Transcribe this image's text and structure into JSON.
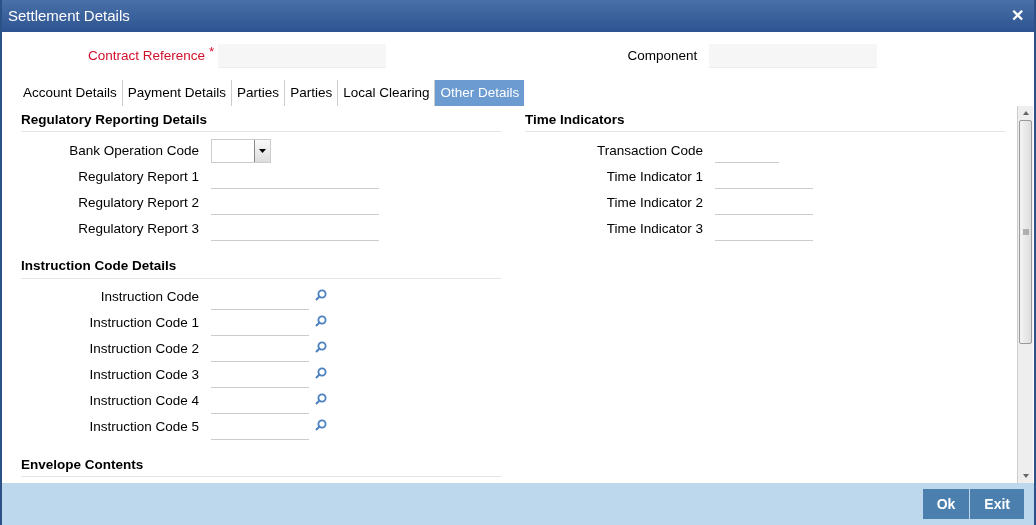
{
  "window": {
    "title": "Settlement Details",
    "close": "✕"
  },
  "header": {
    "contract_reference": {
      "label": "Contract Reference",
      "required": true,
      "required_mark": "*"
    },
    "component": {
      "label": "Component"
    }
  },
  "tabs": [
    {
      "label": "Account Details",
      "selected": false
    },
    {
      "label": "Payment Details",
      "selected": false
    },
    {
      "label": "Parties",
      "selected": false
    },
    {
      "label": "Parties",
      "selected": false
    },
    {
      "label": "Local Clearing",
      "selected": false
    },
    {
      "label": "Other Details",
      "selected": true
    }
  ],
  "left_sections": [
    {
      "title": "Regulatory Reporting Details",
      "fields": [
        {
          "label": "Bank Operation Code",
          "kind": "select"
        },
        {
          "label": "Regulatory Report 1",
          "kind": "text"
        },
        {
          "label": "Regulatory Report 2",
          "kind": "text"
        },
        {
          "label": "Regulatory Report 3",
          "kind": "text"
        }
      ]
    },
    {
      "title": "Instruction Code Details",
      "fields": [
        {
          "label": "Instruction Code",
          "kind": "lookup"
        },
        {
          "label": "Instruction Code 1",
          "kind": "lookup"
        },
        {
          "label": "Instruction Code 2",
          "kind": "lookup"
        },
        {
          "label": "Instruction Code 3",
          "kind": "lookup"
        },
        {
          "label": "Instruction Code 4",
          "kind": "lookup"
        },
        {
          "label": "Instruction Code 5",
          "kind": "lookup"
        }
      ]
    },
    {
      "title": "Envelope Contents"
    }
  ],
  "right_sections": [
    {
      "title": "Time Indicators",
      "fields": [
        {
          "label": "Transaction Code",
          "kind": "short"
        },
        {
          "label": "Time Indicator 1",
          "kind": "text"
        },
        {
          "label": "Time Indicator 2",
          "kind": "text"
        },
        {
          "label": "Time Indicator 3",
          "kind": "text"
        }
      ]
    }
  ],
  "buttons": [
    "Ok",
    "Exit"
  ]
}
